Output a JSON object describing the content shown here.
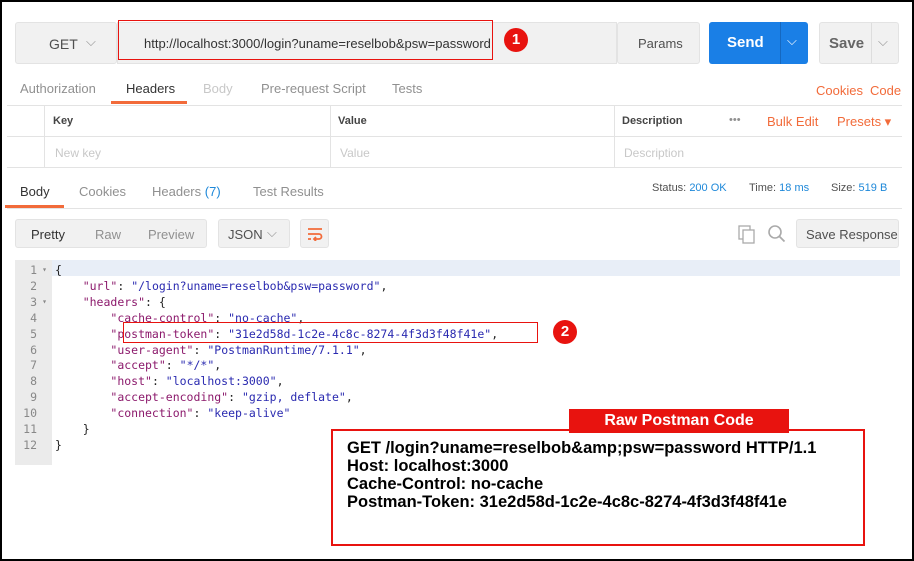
{
  "request": {
    "method": "GET",
    "url": "http://localhost:3000/login?uname=reselbob&psw=password",
    "params_label": "Params",
    "send_label": "Send",
    "save_label": "Save"
  },
  "request_tabs": [
    {
      "label": "Authorization"
    },
    {
      "label": "Headers",
      "active": true
    },
    {
      "label": "Body",
      "disabled": true
    },
    {
      "label": "Pre-request Script"
    },
    {
      "label": "Tests"
    }
  ],
  "request_links": {
    "cookies": "Cookies",
    "code": "Code"
  },
  "headers_table": {
    "columns": [
      "Key",
      "Value",
      "Description"
    ],
    "more": "•••",
    "bulk_edit": "Bulk Edit",
    "presets": "Presets ▾",
    "placeholders": {
      "key": "New key",
      "value": "Value",
      "description": "Description"
    }
  },
  "response_tabs": [
    {
      "label": "Body",
      "active": true
    },
    {
      "label": "Cookies"
    },
    {
      "label": "Headers",
      "count": "(7)"
    },
    {
      "label": "Test Results"
    }
  ],
  "status": {
    "status_label": "Status:",
    "status_value": "200 OK",
    "time_label": "Time:",
    "time_value": "18 ms",
    "size_label": "Size:",
    "size_value": "519 B"
  },
  "view_modes": [
    "Pretty",
    "Raw",
    "Preview"
  ],
  "format": "JSON",
  "save_response": "Save Response",
  "icons": {
    "wrap": "wrap-lines-icon",
    "copy": "copy-icon",
    "search": "search-icon"
  },
  "code_lines": [
    {
      "n": "1",
      "fold": true,
      "parts": [
        [
          "p",
          "{"
        ]
      ]
    },
    {
      "n": "2",
      "parts": [
        [
          "p",
          "    "
        ],
        [
          "k",
          "\"url\""
        ],
        [
          "p",
          ": "
        ],
        [
          "s",
          "\"/login?uname=reselbob&psw=password\""
        ],
        [
          "p",
          ","
        ]
      ]
    },
    {
      "n": "3",
      "fold": true,
      "parts": [
        [
          "p",
          "    "
        ],
        [
          "k",
          "\"headers\""
        ],
        [
          "p",
          ": {"
        ]
      ]
    },
    {
      "n": "4",
      "parts": [
        [
          "p",
          "        "
        ],
        [
          "k",
          "\"cache-control\""
        ],
        [
          "p",
          ": "
        ],
        [
          "s",
          "\"no-cache\""
        ],
        [
          "p",
          ","
        ]
      ]
    },
    {
      "n": "5",
      "parts": [
        [
          "p",
          "        "
        ],
        [
          "k",
          "\"postman-token\""
        ],
        [
          "p",
          ": "
        ],
        [
          "s",
          "\"31e2d58d-1c2e-4c8c-8274-4f3d3f48f41e\""
        ],
        [
          "p",
          ","
        ]
      ]
    },
    {
      "n": "6",
      "parts": [
        [
          "p",
          "        "
        ],
        [
          "k",
          "\"user-agent\""
        ],
        [
          "p",
          ": "
        ],
        [
          "s",
          "\"PostmanRuntime/7.1.1\""
        ],
        [
          "p",
          ","
        ]
      ]
    },
    {
      "n": "7",
      "parts": [
        [
          "p",
          "        "
        ],
        [
          "k",
          "\"accept\""
        ],
        [
          "p",
          ": "
        ],
        [
          "s",
          "\"*/*\""
        ],
        [
          "p",
          ","
        ]
      ]
    },
    {
      "n": "8",
      "parts": [
        [
          "p",
          "        "
        ],
        [
          "k",
          "\"host\""
        ],
        [
          "p",
          ": "
        ],
        [
          "s",
          "\"localhost:3000\""
        ],
        [
          "p",
          ","
        ]
      ]
    },
    {
      "n": "9",
      "parts": [
        [
          "p",
          "        "
        ],
        [
          "k",
          "\"accept-encoding\""
        ],
        [
          "p",
          ": "
        ],
        [
          "s",
          "\"gzip, deflate\""
        ],
        [
          "p",
          ","
        ]
      ]
    },
    {
      "n": "10",
      "parts": [
        [
          "p",
          "        "
        ],
        [
          "k",
          "\"connection\""
        ],
        [
          "p",
          ": "
        ],
        [
          "s",
          "\"keep-alive\""
        ]
      ]
    },
    {
      "n": "11",
      "parts": [
        [
          "p",
          "    }"
        ]
      ]
    },
    {
      "n": "12",
      "parts": [
        [
          "p",
          "}"
        ]
      ]
    }
  ],
  "annotations": {
    "badge1": "1",
    "badge2": "2",
    "raw_title": "Raw Postman Code",
    "raw_lines": [
      "GET /login?uname=reselbob&amp;psw=password HTTP/1.1",
      "Host: localhost:3000",
      "Cache-Control: no-cache",
      "Postman-Token: 31e2d58d-1c2e-4c8c-8274-4f3d3f48f41e"
    ]
  },
  "colors": {
    "accent": "#f26b3a",
    "send": "#1a7fe6",
    "annotation": "#e8130f"
  }
}
